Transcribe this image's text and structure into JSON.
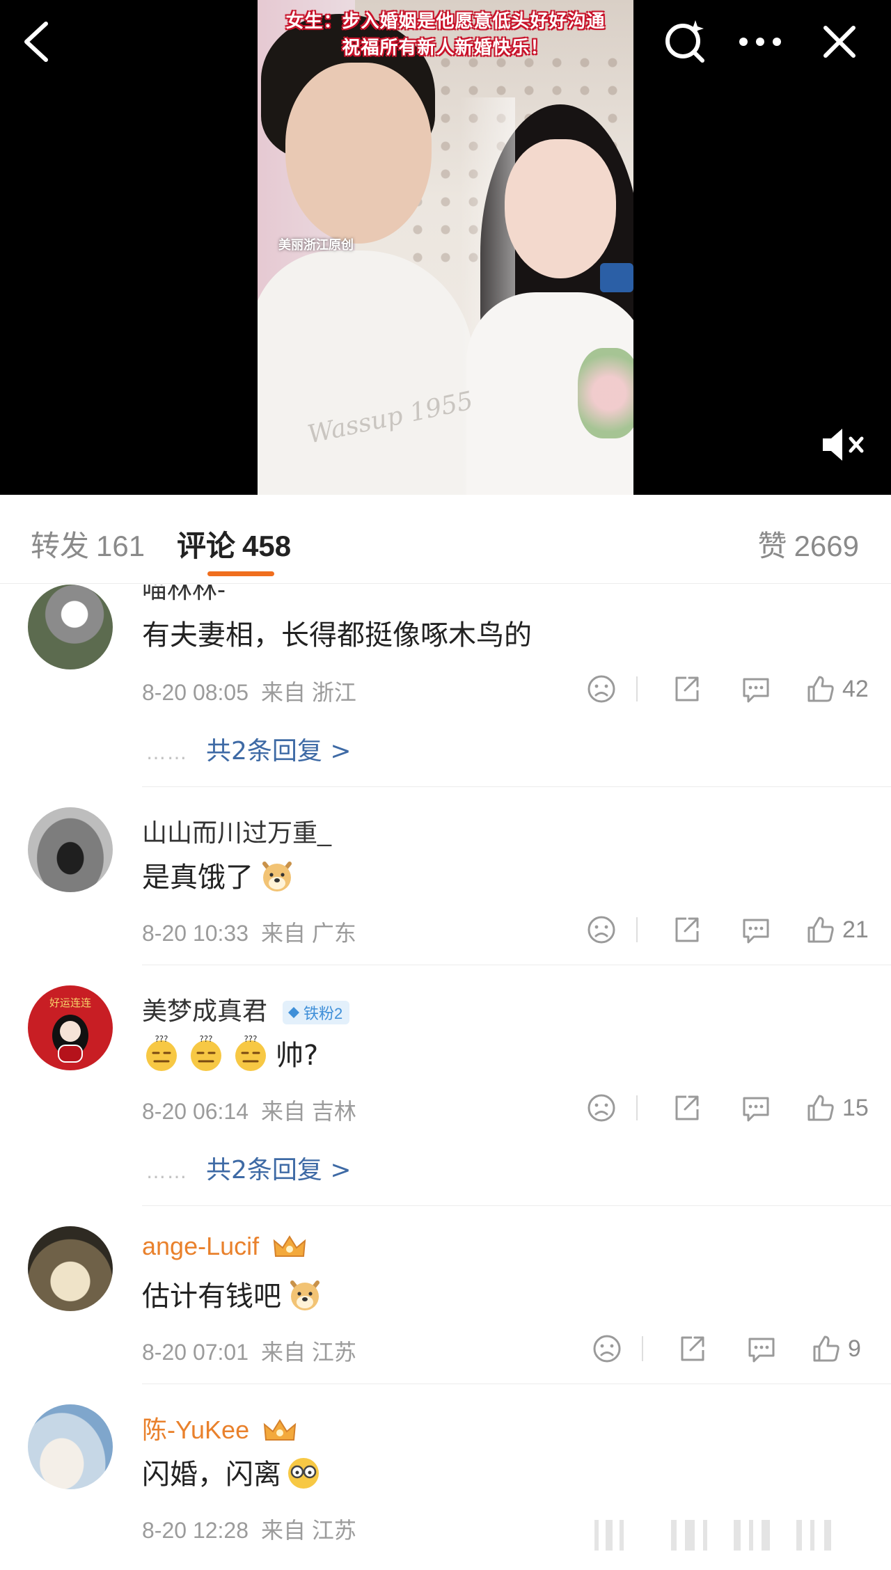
{
  "video": {
    "caption_line1": "女生：步入婚姻是他愿意低头好好沟通",
    "caption_line2": "祝福所有新人新婚快乐！",
    "watermark": "美丽浙江原创",
    "shirt_text": "Wassup 1955"
  },
  "toolbar_icons": {
    "back": "back-arrow-icon",
    "search": "search-sparkle-icon",
    "more": "more-dots-icon",
    "close": "close-icon",
    "mute": "muted-speaker-icon"
  },
  "tabs": {
    "repost": {
      "label": "转发",
      "count": "161"
    },
    "comment": {
      "label": "评论",
      "count": "458"
    },
    "like": {
      "label": "赞",
      "count": "2669"
    }
  },
  "colors": {
    "accent": "#f06e1e",
    "vip_name": "#e9812c",
    "reply_link": "#3e6aa5",
    "caption_stroke": "#c8142b"
  },
  "comments": [
    {
      "user": "喵林林-",
      "text": "有夫妻相，长得都挺像啄木鸟的",
      "date": "8-20 08:05",
      "location": "来自 浙江",
      "likes": "42",
      "replies": "共2条回复 >"
    },
    {
      "user": "山山而川过万重_",
      "text": "是真饿了",
      "date": "8-20 10:33",
      "location": "来自 广东",
      "likes": "21"
    },
    {
      "user": "美梦成真君",
      "badge": "铁粉2",
      "avatar_text": "好运连连",
      "text": "帅?",
      "date": "8-20 06:14",
      "location": "来自 吉林",
      "likes": "15",
      "replies": "共2条回复 >"
    },
    {
      "user": "ange-Lucif",
      "text": "估计有钱吧",
      "date": "8-20 07:01",
      "location": "来自 江苏",
      "likes": "9"
    },
    {
      "user": "陈-YuKee",
      "text": "闪婚，闪离",
      "date": "8-20 12:28",
      "location": "来自 江苏"
    }
  ],
  "reply_dots": "……"
}
